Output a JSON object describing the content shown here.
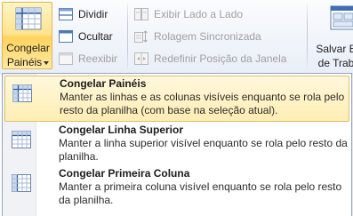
{
  "ribbon": {
    "freeze_panes": {
      "label_line1": "Congelar",
      "label_line2": "Painéis",
      "icon": "freeze-panes-icon"
    },
    "split": {
      "label": "Dividir",
      "icon": "split-icon",
      "enabled": true
    },
    "hide": {
      "label": "Ocultar",
      "icon": "hide-window-icon",
      "enabled": true
    },
    "unhide": {
      "label": "Reexibir",
      "icon": "unhide-window-icon",
      "enabled": false
    },
    "view_side_by_side": {
      "label": "Exibir Lado a Lado",
      "icon": "side-by-side-icon",
      "enabled": false
    },
    "synchronous_scrolling": {
      "label": "Rolagem Sincronizada",
      "icon": "sync-scroll-icon",
      "enabled": false
    },
    "reset_window_position": {
      "label": "Redefinir Posição da Janela",
      "icon": "reset-window-position-icon",
      "enabled": false
    },
    "save_workspace": {
      "label_line1": "Salvar E",
      "label_line2": "de Trab",
      "icon": "save-workspace-icon"
    }
  },
  "menu": {
    "items": [
      {
        "title": "Congelar Painéis",
        "description": "Manter as linhas e as colunas visíveis enquanto se rola pelo resto da planilha (com base na seleção atual).",
        "icon": "freeze-panes-icon"
      },
      {
        "title": "Congelar Linha Superior",
        "description": "Manter a linha superior visível enquanto se rola pelo resto da planilha.",
        "icon": "freeze-top-row-icon"
      },
      {
        "title": "Congelar Primeira Coluna",
        "description": "Manter a primeira coluna visível enquanto se rola pelo resto da planilha.",
        "icon": "freeze-first-column-icon"
      }
    ]
  },
  "colors": {
    "hover_border": "#dfbf6d",
    "hover_fill": "#ffedb3",
    "menu_border": "#97a7bc",
    "disabled_text": "#a0a0a0"
  }
}
